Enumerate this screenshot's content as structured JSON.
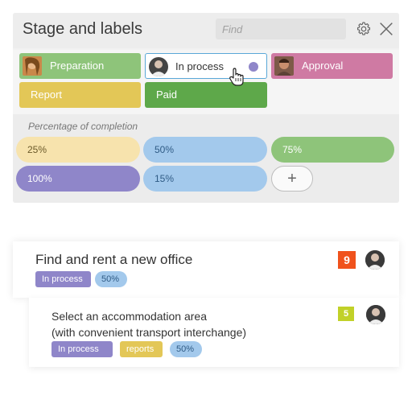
{
  "panel": {
    "title": "Stage and labels",
    "find_placeholder": "Find"
  },
  "stages": [
    {
      "label": "Preparation",
      "color": "#8ec47a",
      "has_avatar": true
    },
    {
      "label": "In process",
      "color": "#ffffff",
      "has_avatar": true,
      "selected": true,
      "dot_color": "#8f86c9"
    },
    {
      "label": "Approval",
      "color": "#cf7aa3",
      "has_avatar": true
    },
    {
      "label": "Report",
      "color": "#e3c757",
      "has_avatar": false
    },
    {
      "label": "Paid",
      "color": "#5ea84a",
      "has_avatar": false
    }
  ],
  "completion": {
    "title": "Percentage of completion",
    "items": [
      {
        "label": "25%",
        "color": "#f7e3ad",
        "text_color": "#6b5a2a"
      },
      {
        "label": "50%",
        "color": "#a3c9ec",
        "text_color": "#2f5b85"
      },
      {
        "label": "75%",
        "color": "#8ec47a",
        "text_color": "#ffffff"
      },
      {
        "label": "100%",
        "color": "#8f86c9",
        "text_color": "#ffffff"
      },
      {
        "label": "15%",
        "color": "#a3c9ec",
        "text_color": "#2f5b85"
      }
    ],
    "add_label": "+"
  },
  "tasks": [
    {
      "title": "Find and rent a new office",
      "badge": "9",
      "badge_color": "#f0521c",
      "tags": [
        {
          "label": "In process",
          "color": "#8f86c9",
          "text_color": "#ffffff"
        },
        {
          "label": "50%",
          "color": "#a3c9ec",
          "text_color": "#2f5b85"
        }
      ]
    },
    {
      "title_line1": "Select an accommodation area",
      "title_line2": "(with convenient transport interchange)",
      "badge": "5",
      "badge_color": "#c1d128",
      "tags": [
        {
          "label": "In process",
          "color": "#8f86c9",
          "text_color": "#ffffff"
        },
        {
          "label": "reports",
          "color": "#e3c757",
          "text_color": "#ffffff"
        },
        {
          "label": "50%",
          "color": "#a3c9ec",
          "text_color": "#2f5b85"
        }
      ]
    }
  ]
}
